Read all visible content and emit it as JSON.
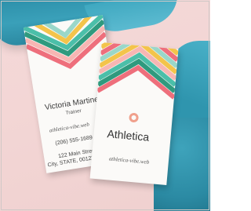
{
  "colors": {
    "towel": "#2f95ae",
    "background": "#f3d6d5",
    "stripe_teal": "#4bbfa9",
    "stripe_yellow": "#f3c44b",
    "stripe_pink": "#ee6f7c",
    "stripe_green": "#2f9a7e"
  },
  "back_card": {
    "name": "Victoria Martine",
    "role": "Trainer",
    "website": "athletica-vibe.web",
    "phone": "(206) 555-1689",
    "street": "122 Main Street",
    "city": "City, STATE, 00123"
  },
  "front_card": {
    "logo_icon": "circle-logo-icon",
    "brand": "Athletica",
    "website": "athletica-vibe.web"
  }
}
